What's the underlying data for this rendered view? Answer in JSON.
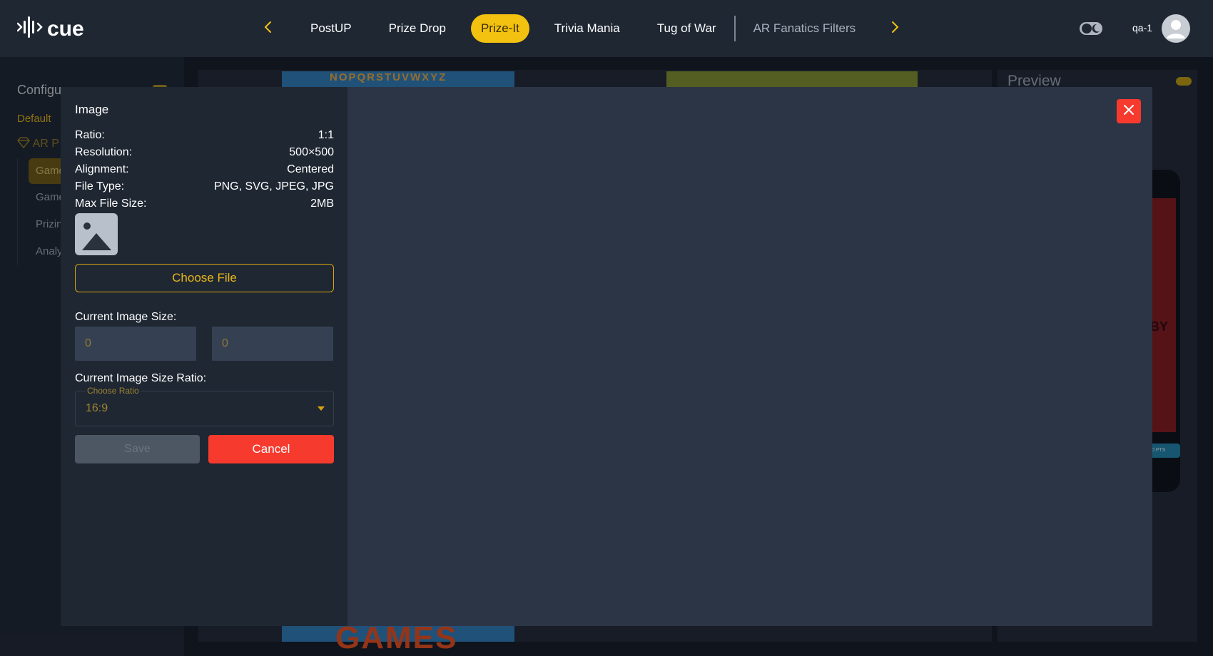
{
  "app": {
    "logo_text": "cue"
  },
  "nav": {
    "tabs": [
      {
        "label": "PostUP"
      },
      {
        "label": "Prize Drop"
      },
      {
        "label": "Prize-It"
      },
      {
        "label": "Trivia Mania"
      },
      {
        "label": "Tug of War"
      },
      {
        "label": "AR Fanatics Filters"
      }
    ],
    "active_tab": "Prize-It",
    "user_name": "qa-1"
  },
  "background": {
    "sidebar_title": "Configur",
    "default_label": "Default",
    "ar_label": "AR P",
    "items": [
      "Game",
      "Game",
      "Prizin",
      "Analy"
    ],
    "card_text": "NOPQRSTUVWXYZ",
    "games_text": "GAMES",
    "preview_title": "Preview",
    "phone_text": "BY",
    "phone_pill": "0 PTS"
  },
  "modal": {
    "title": "Image",
    "specs": [
      {
        "label": "Ratio:",
        "value": "1:1"
      },
      {
        "label": "Resolution:",
        "value": "500×500"
      },
      {
        "label": "Alignment:",
        "value": "Centered"
      },
      {
        "label": "File Type:",
        "value": "PNG, SVG, JPEG, JPG"
      },
      {
        "label": "Max File Size:",
        "value": "2MB"
      }
    ],
    "choose_file_label": "Choose File",
    "current_size_label": "Current Image Size:",
    "width_value": "0",
    "height_value": "0",
    "ratio_label": "Current Image Size Ratio:",
    "ratio_select_legend": "Choose Ratio",
    "ratio_selected": "16:9",
    "save_label": "Save",
    "cancel_label": "Cancel"
  },
  "colors": {
    "accent": "#f3c10f",
    "danger": "#f73a2e",
    "topbar": "#1f2733",
    "modal_panel": "#1f2732",
    "modal_body": "#2c3545"
  }
}
